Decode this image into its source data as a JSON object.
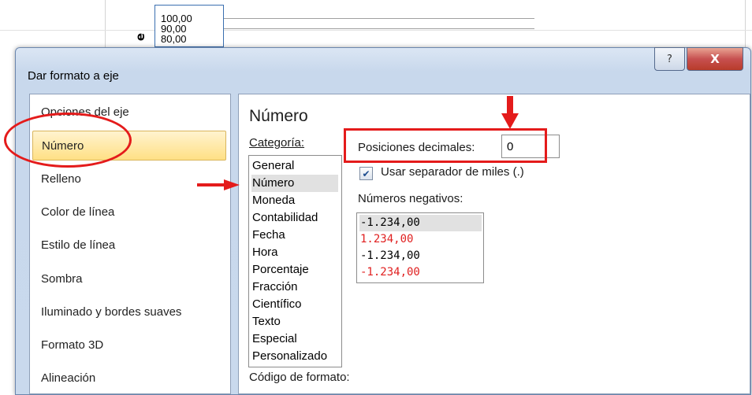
{
  "chart": {
    "tick_labels": [
      "100,00",
      "90,00",
      "80,00"
    ],
    "axis_letter": "e"
  },
  "dialog": {
    "title": "Dar formato a eje",
    "help_glyph": "?",
    "close_glyph": "X"
  },
  "nav": {
    "items": [
      {
        "label": "Opciones del eje",
        "selected": false
      },
      {
        "label": "Número",
        "selected": true
      },
      {
        "label": "Relleno",
        "selected": false
      },
      {
        "label": "Color de línea",
        "selected": false
      },
      {
        "label": "Estilo de línea",
        "selected": false
      },
      {
        "label": "Sombra",
        "selected": false
      },
      {
        "label": "Iluminado y bordes suaves",
        "selected": false
      },
      {
        "label": "Formato 3D",
        "selected": false
      },
      {
        "label": "Alineación",
        "selected": false
      }
    ]
  },
  "panel": {
    "title": "Número",
    "category_label": "Categoría:",
    "categories": [
      "General",
      "Número",
      "Moneda",
      "Contabilidad",
      "Fecha",
      "Hora",
      "Porcentaje",
      "Fracción",
      "Científico",
      "Texto",
      "Especial",
      "Personalizado"
    ],
    "selected_category": "Número",
    "decimal_label": "Posiciones decimales:",
    "decimal_value": "0",
    "thousands_label": "Usar separador de miles (.)",
    "thousands_checked": true,
    "negative_label": "Números negativos:",
    "negative_options": [
      {
        "text": "-1.234,00",
        "red": false,
        "selected": true
      },
      {
        "text": "1.234,00",
        "red": true,
        "selected": false
      },
      {
        "text": "-1.234,00",
        "red": false,
        "selected": false
      },
      {
        "text": "-1.234,00",
        "red": true,
        "selected": false
      }
    ],
    "format_code_label": "Código de formato:"
  },
  "annotations": {
    "color": "#e41b1b"
  }
}
